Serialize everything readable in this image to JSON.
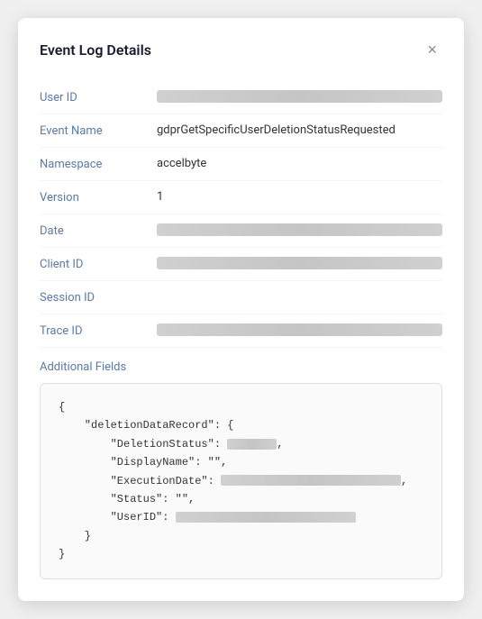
{
  "modal": {
    "title": "Event Log Details",
    "close_label": "×"
  },
  "fields": [
    {
      "label": "User ID",
      "value": "BLURRED_LONG",
      "type": "blurred-long"
    },
    {
      "label": "Event Name",
      "value": "gdprGetSpecificUserDeletionStatusRequested",
      "type": "text"
    },
    {
      "label": "Namespace",
      "value": "accelbyte",
      "type": "text"
    },
    {
      "label": "Version",
      "value": "1",
      "type": "text"
    },
    {
      "label": "Date",
      "value": "BLURRED_SHORT",
      "type": "blurred-short"
    },
    {
      "label": "Client ID",
      "value": "BLURRED_LONG",
      "type": "blurred-long"
    },
    {
      "label": "Session ID",
      "value": "",
      "type": "empty"
    },
    {
      "label": "Trace ID",
      "value": "BLURRED_LONG",
      "type": "blurred-long"
    }
  ],
  "additional_fields": {
    "label": "Additional Fields"
  },
  "json_content": {
    "deletion_data_record_key": "\"deletionDataRecord\": {",
    "deletion_status_key": "\"DeletionStatus\":",
    "display_name_key": "\"DisplayName\":",
    "display_name_val": "\"\",",
    "execution_date_key": "\"ExecutionDate\":",
    "status_key": "\"Status\":",
    "status_val": "\"\",",
    "user_id_key": "\"UserID\":"
  }
}
